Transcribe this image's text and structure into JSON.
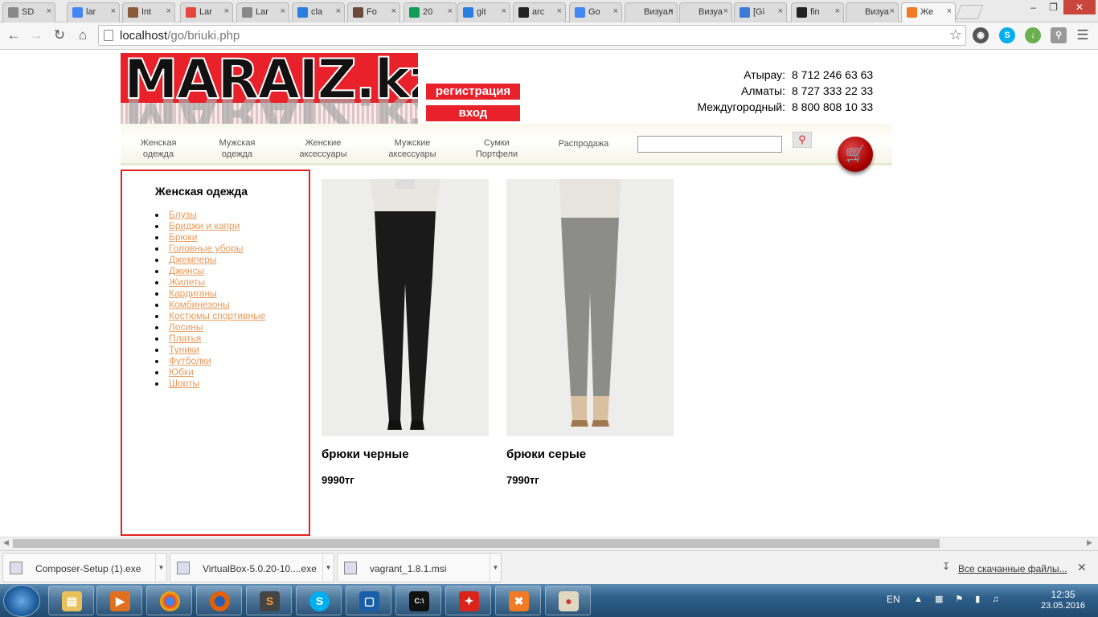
{
  "browser": {
    "tabs": [
      {
        "label": "SD",
        "icon": "page-icon",
        "color": "#888"
      },
      {
        "label": "lar",
        "icon": "google-icon",
        "color": "#4285f4"
      },
      {
        "label": "Int",
        "icon": "avatar-icon",
        "color": "#8a5a3a"
      },
      {
        "label": "Lar",
        "icon": "laravel-icon",
        "color": "#e8453c"
      },
      {
        "label": "Lar",
        "icon": "page-icon",
        "color": "#888"
      },
      {
        "label": "cla",
        "icon": "search-icon",
        "color": "#2a7de1"
      },
      {
        "label": "Fo",
        "icon": "avatar-icon",
        "color": "#6a4a3a"
      },
      {
        "label": "20",
        "icon": "sheets-icon",
        "color": "#0f9d58"
      },
      {
        "label": "git",
        "icon": "search-icon",
        "color": "#2a7de1"
      },
      {
        "label": "arc",
        "icon": "github-icon",
        "color": "#222"
      },
      {
        "label": "Go",
        "icon": "google-icon",
        "color": "#4285f4"
      },
      {
        "label": "Визуал",
        "icon": "none",
        "color": "#ddd"
      },
      {
        "label": "Визуа",
        "icon": "none",
        "color": "#ddd"
      },
      {
        "label": "[Gi",
        "icon": "at-icon",
        "color": "#3a7bd5"
      },
      {
        "label": "fin",
        "icon": "github-icon",
        "color": "#222"
      },
      {
        "label": "Визуа",
        "icon": "none",
        "color": "#ddd"
      },
      {
        "label": "Же",
        "icon": "xampp-icon",
        "color": "#f07b24"
      }
    ],
    "url_host": "localhost",
    "url_path": "/go/briuki.php"
  },
  "site": {
    "logo_text": "MARAIZ.kz",
    "register_label": "регистрация",
    "login_label": "вход",
    "phones": [
      {
        "city": "Атырау:",
        "number": "8 712 246 63 63"
      },
      {
        "city": "Алматы:",
        "number": "8 727 333 22 33"
      },
      {
        "city": "Междугородный:",
        "number": "8 800 808 10 33"
      }
    ],
    "menu": [
      {
        "line1": "Женская",
        "line2": "одежда"
      },
      {
        "line1": "Мужская",
        "line2": "одежда"
      },
      {
        "line1": "Женские",
        "line2": "аксессуары"
      },
      {
        "line1": "Мужские",
        "line2": "аксессуары"
      },
      {
        "line1": "Сумки",
        "line2": "Портфели"
      },
      {
        "line1": "Распродажа",
        "line2": ""
      }
    ],
    "search_value": "",
    "sidebar": {
      "title": "Женская одежда",
      "items": [
        "Блузы",
        "Бриджи и капри",
        "Брюки",
        "Головные уборы",
        "Джемперы",
        "Джинсы",
        "Жилеты",
        "Кардиганы",
        "Комбинезоны",
        "Костюмы спортивные",
        "Лосины",
        "Платья",
        "Туники",
        "Футболки",
        "Юбки",
        "Шорты"
      ]
    },
    "products": [
      {
        "name": "брюки черные",
        "price": "9990тг",
        "pants_color": "#1a1a1a"
      },
      {
        "name": "брюки серые",
        "price": "7990тг",
        "pants_color": "#8c8c88"
      }
    ]
  },
  "downloads": {
    "items": [
      "Composer-Setup (1).exe",
      "VirtualBox-5.0.20-10....exe",
      "vagrant_1.8.1.msi"
    ],
    "all_label": "Все скачанные файлы..."
  },
  "taskbar": {
    "lang": "EN",
    "time": "12:35",
    "date": "23.05.2016"
  }
}
